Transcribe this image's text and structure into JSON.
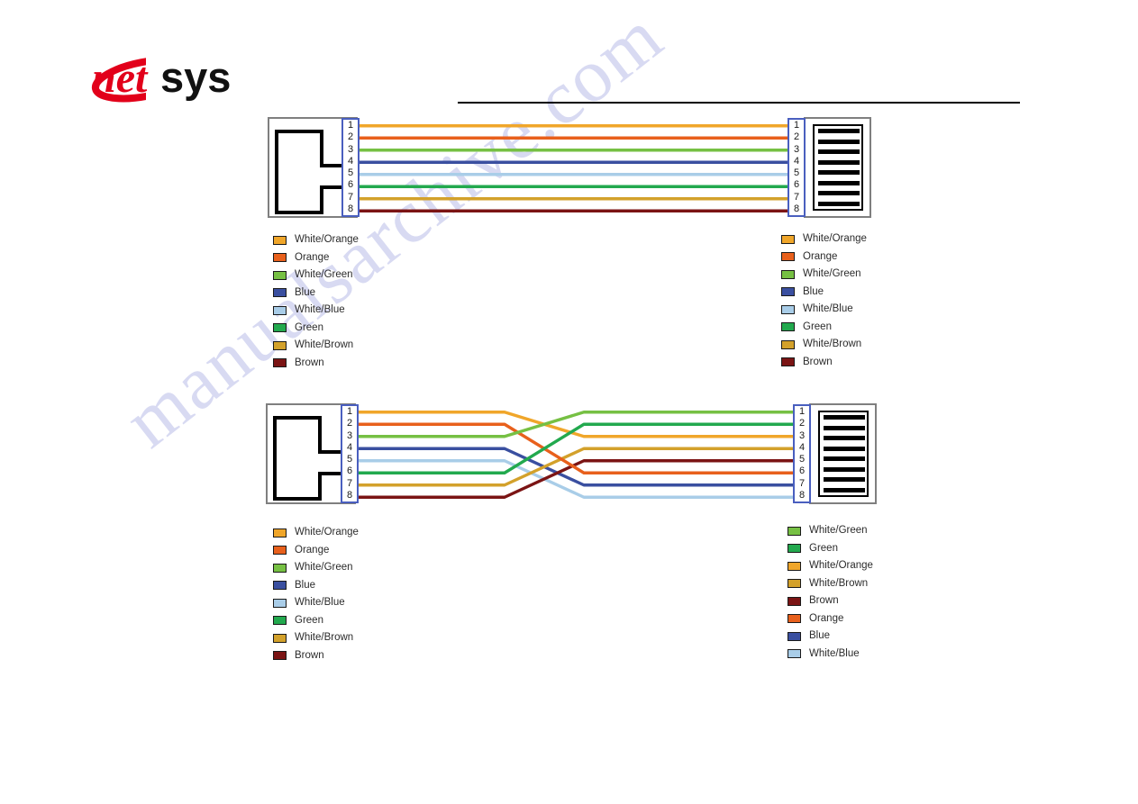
{
  "page": {
    "watermark": "manualsarchive.com",
    "logo": {
      "text_primary": "net",
      "text_secondary": "sys",
      "color_primary": "#E2001A",
      "color_secondary": "#111111"
    }
  },
  "colors": {
    "White/Orange": "#F0A62A",
    "Orange": "#E8601C",
    "White/Green": "#76C043",
    "Blue": "#3A4FA0",
    "White/Blue": "#A9CDE8",
    "Green": "#22A94E",
    "White/Brown": "#D3A12B",
    "Brown": "#7B1414",
    "pin_border": "#4a5fbf",
    "plug_border": "#7f7f7f",
    "jack_bar": "#000000",
    "rule": "#000000",
    "watermark": "#b9bde8"
  },
  "diagrams": [
    {
      "id": "straight-through",
      "name": "straight-through-cable",
      "left_connector": {
        "type": "rj45-plug",
        "pins": [
          "1",
          "2",
          "3",
          "4",
          "5",
          "6",
          "7",
          "8"
        ]
      },
      "right_connector": {
        "type": "rj45-jack",
        "pins": [
          "1",
          "2",
          "3",
          "4",
          "5",
          "6",
          "7",
          "8"
        ],
        "contacts": 8
      },
      "left_legend": [
        "White/Orange",
        "Orange",
        "White/Green",
        "Blue",
        "White/Blue",
        "Green",
        "White/Brown",
        "Brown"
      ],
      "right_legend": [
        "White/Orange",
        "Orange",
        "White/Green",
        "Blue",
        "White/Blue",
        "Green",
        "White/Brown",
        "Brown"
      ],
      "wiring": [
        {
          "left_pin": 1,
          "right_pin": 1,
          "color": "White/Orange"
        },
        {
          "left_pin": 2,
          "right_pin": 2,
          "color": "Orange"
        },
        {
          "left_pin": 3,
          "right_pin": 3,
          "color": "White/Green"
        },
        {
          "left_pin": 4,
          "right_pin": 4,
          "color": "Blue"
        },
        {
          "left_pin": 5,
          "right_pin": 5,
          "color": "White/Blue"
        },
        {
          "left_pin": 6,
          "right_pin": 6,
          "color": "Green"
        },
        {
          "left_pin": 7,
          "right_pin": 7,
          "color": "White/Brown"
        },
        {
          "left_pin": 8,
          "right_pin": 8,
          "color": "Brown"
        }
      ]
    },
    {
      "id": "crossover",
      "name": "crossover-cable",
      "left_connector": {
        "type": "rj45-plug",
        "pins": [
          "1",
          "2",
          "3",
          "4",
          "5",
          "6",
          "7",
          "8"
        ]
      },
      "right_connector": {
        "type": "rj45-jack",
        "pins": [
          "1",
          "2",
          "3",
          "4",
          "5",
          "6",
          "7",
          "8"
        ],
        "contacts": 8
      },
      "left_legend": [
        "White/Orange",
        "Orange",
        "White/Green",
        "Blue",
        "White/Blue",
        "Green",
        "White/Brown",
        "Brown"
      ],
      "right_legend": [
        "White/Green",
        "Green",
        "White/Orange",
        "White/Brown",
        "Brown",
        "Orange",
        "Blue",
        "White/Blue"
      ],
      "wiring": [
        {
          "left_pin": 1,
          "right_pin": 3,
          "color": "White/Orange"
        },
        {
          "left_pin": 2,
          "right_pin": 6,
          "color": "Orange"
        },
        {
          "left_pin": 3,
          "right_pin": 1,
          "color": "White/Green"
        },
        {
          "left_pin": 4,
          "right_pin": 7,
          "color": "Blue"
        },
        {
          "left_pin": 5,
          "right_pin": 8,
          "color": "White/Blue"
        },
        {
          "left_pin": 6,
          "right_pin": 2,
          "color": "Green"
        },
        {
          "left_pin": 7,
          "right_pin": 4,
          "color": "White/Brown"
        },
        {
          "left_pin": 8,
          "right_pin": 5,
          "color": "Brown"
        }
      ]
    }
  ]
}
